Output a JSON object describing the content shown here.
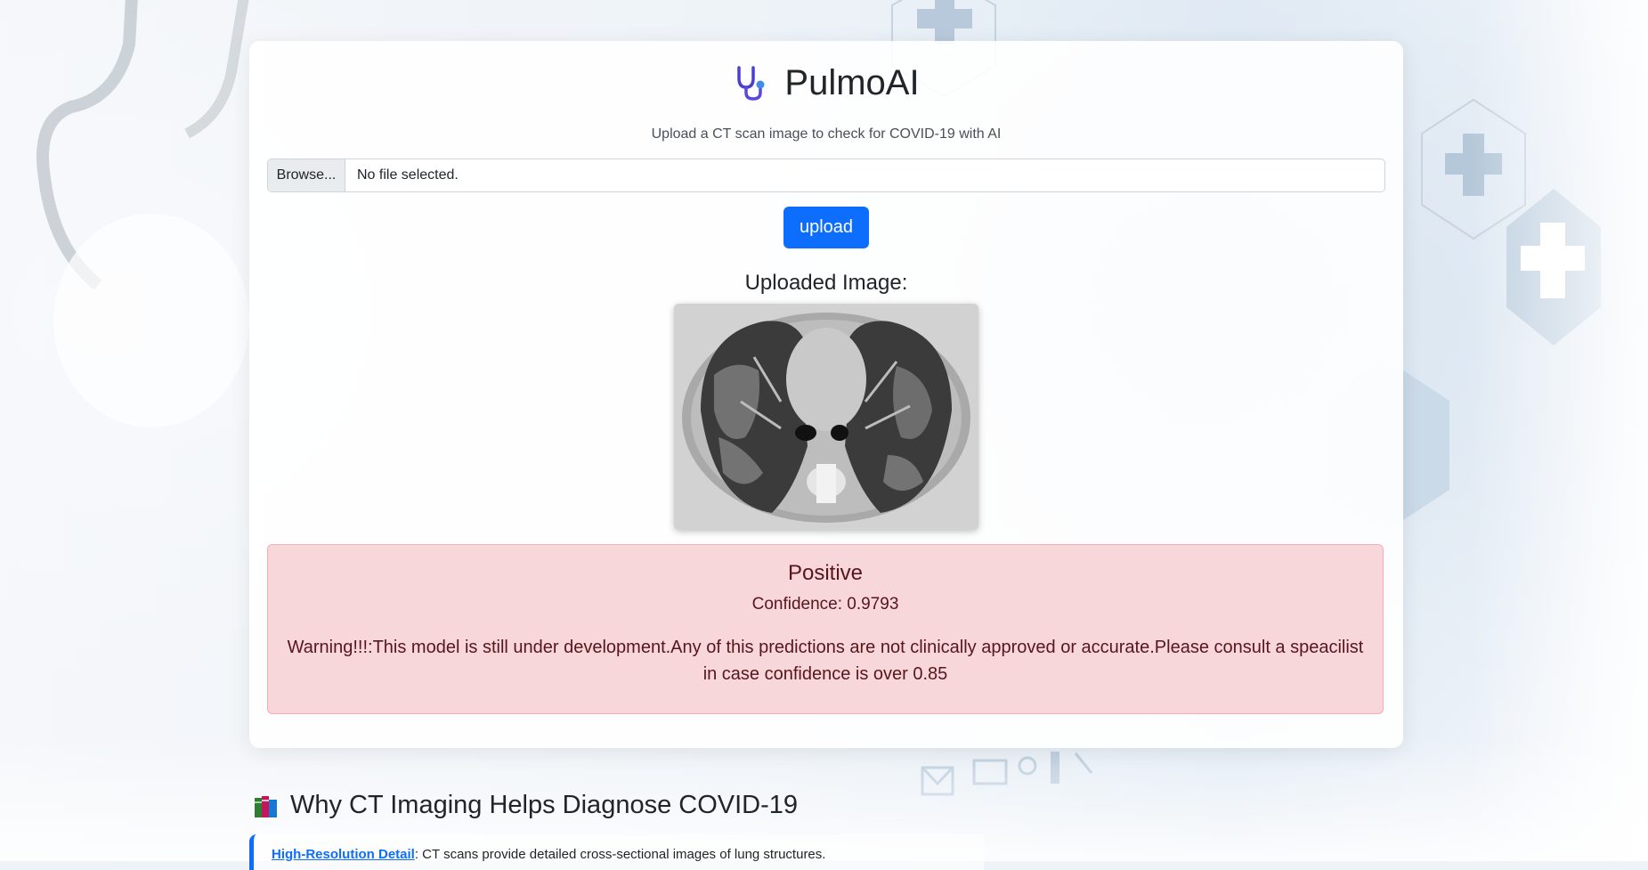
{
  "app": {
    "title": "PulmoAI",
    "subtitle": "Upload a CT scan image to check for COVID-19 with AI",
    "logo_icon": "stethoscope-icon"
  },
  "file_input": {
    "browse_label": "Browse...",
    "status": "No file selected."
  },
  "upload_button": {
    "label": "upload"
  },
  "uploaded_section": {
    "label": "Uploaded Image:"
  },
  "result": {
    "label": "Positive",
    "confidence": "Confidence: 0.9793",
    "warning": "Warning!!!:This model is still under development.Any of this predictions are not clinically approved or accurate.Please consult a speacilist in case confidence is over 0.85"
  },
  "info": {
    "title": "Why CT Imaging Helps Diagnose COVID-19",
    "title_icon": "books-icon",
    "items": [
      {
        "term": "High-Resolution Detail",
        "text": ": CT scans provide detailed cross-sectional images of lung structures."
      }
    ]
  },
  "colors": {
    "primary": "#0d6efd",
    "danger_bg": "#f8d7da",
    "danger_text": "#58151c",
    "danger_border": "#f1aeb5"
  }
}
